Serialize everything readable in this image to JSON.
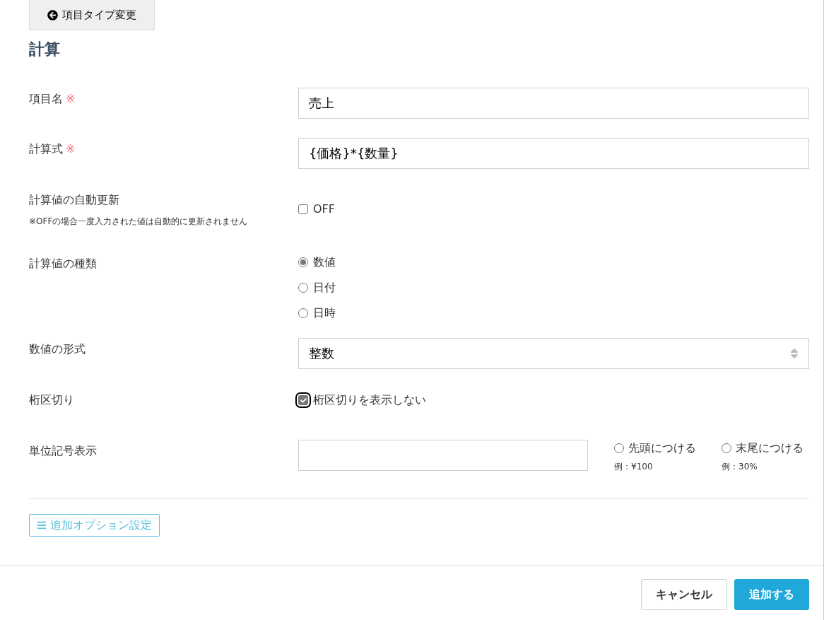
{
  "back_button": {
    "label": "項目タイプ変更"
  },
  "title": "計算",
  "fields": [
    {
      "kind": "text",
      "label": "項目名",
      "required_mark": "※",
      "value": "売上"
    },
    {
      "kind": "text",
      "label": "計算式",
      "required_mark": "※",
      "value": "{価格}*{数量}"
    },
    {
      "kind": "checkbox",
      "label": "計算値の自動更新",
      "note": "※OFFの場合一度入力された値は自動的に更新されません",
      "option": {
        "label": "OFF",
        "checked": false,
        "focused": false
      }
    },
    {
      "kind": "radio",
      "label": "計算値の種類",
      "options": [
        {
          "label": "数値",
          "selected": true
        },
        {
          "label": "日付",
          "selected": false
        },
        {
          "label": "日時",
          "selected": false
        }
      ]
    },
    {
      "kind": "select",
      "label": "数値の形式",
      "value": "整数"
    },
    {
      "kind": "checkbox",
      "label": "桁区切り",
      "option": {
        "label": "桁区切りを表示しない",
        "checked": true,
        "focused": true
      }
    },
    {
      "kind": "unit",
      "label": "単位記号表示",
      "options": [
        {
          "label": "先頭につける",
          "example": "例：¥100",
          "selected": false
        },
        {
          "label": "末尾につける",
          "example": "例：30%",
          "selected": false
        }
      ]
    }
  ],
  "options_button": {
    "label": "追加オプション設定"
  },
  "footer": {
    "buttons": [
      {
        "label": "キャンセル",
        "kind": "secondary"
      },
      {
        "label": "追加する",
        "kind": "primary"
      }
    ]
  }
}
